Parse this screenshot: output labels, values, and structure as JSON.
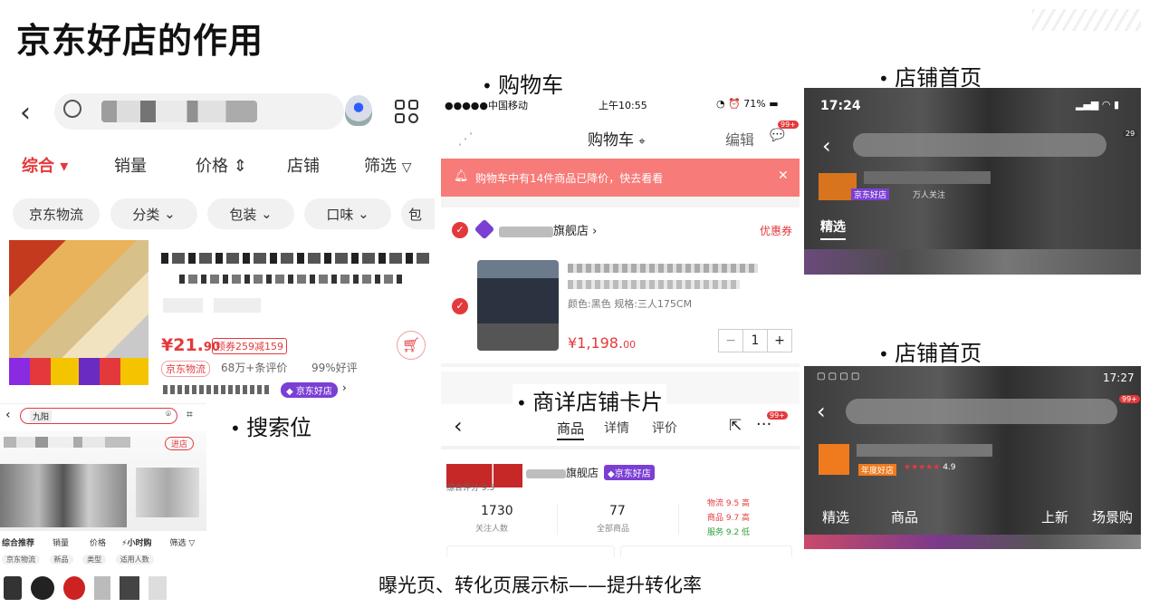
{
  "slide_title": "京东好店的作用",
  "bottom_caption": "曝光页、转化页展示标——提升转化率",
  "bullets": {
    "search": "搜索位",
    "cart": "购物车",
    "detail_card": "商详店铺卡片",
    "store_home_1": "店铺首页",
    "store_home_2": "店铺首页"
  },
  "search_panel": {
    "sort_tabs": [
      "综合",
      "销量",
      "价格",
      "店铺",
      "筛选"
    ],
    "chips": [
      "京东物流",
      "分类",
      "包装",
      "口味",
      "包"
    ],
    "price_main": "¥21.",
    "price_dec": "90",
    "coupon": "领券259减159",
    "jd_logistics_tag": "京东物流",
    "reviews": "68万+条评价",
    "good_rate": "99%好评",
    "haodian_badge": "京东好店",
    "sub_search_query": "九阳",
    "sub_tabs": [
      "综合推荐",
      "销量",
      "价格",
      "小时购",
      "筛选"
    ],
    "sub_chips": [
      "京东物流",
      "新品",
      "类型",
      "适用人数"
    ],
    "sub_enter": "进店"
  },
  "cart": {
    "carrier": "中国移动",
    "time": "上午10:55",
    "battery": "71%",
    "title": "购物车",
    "edit": "编辑",
    "msg_badge": "99+",
    "notice": "购物车中有14件商品已降价，快去看看",
    "store_suffix": "旗舰店",
    "coupon_link": "优惠券",
    "spec": "颜色:黑色 规格:三人175CM",
    "price": "¥1,198.",
    "price_dec": "00",
    "qty": "1"
  },
  "detail": {
    "tabs": [
      "商品",
      "详情",
      "评价"
    ],
    "msg_badge": "99+",
    "store_suffix": "旗舰店",
    "haodian_badge": "京东好店",
    "score": "综合评分 9.5",
    "followers": "1730",
    "followers_label": "关注人数",
    "products": "77",
    "products_label": "全部商品",
    "ratings": [
      "物流 9.5 高",
      "商品 9.7 高",
      "服务 9.2 低"
    ]
  },
  "store1": {
    "time": "17:24",
    "badge": "29",
    "haodian_badge": "京东好店",
    "follow": "万人关注",
    "tab": "精选"
  },
  "store2": {
    "time": "17:27",
    "msg_badge": "99+",
    "haodian_badge": "年度好店",
    "rating": "4.9",
    "tabs": [
      "精选",
      "商品",
      "上新",
      "场景购"
    ]
  },
  "colors": {
    "jd_red": "#e4393c",
    "notice_bg": "#f77b78",
    "haodian_purple": "#7b3fd4",
    "store_orange": "#f07b1e"
  }
}
